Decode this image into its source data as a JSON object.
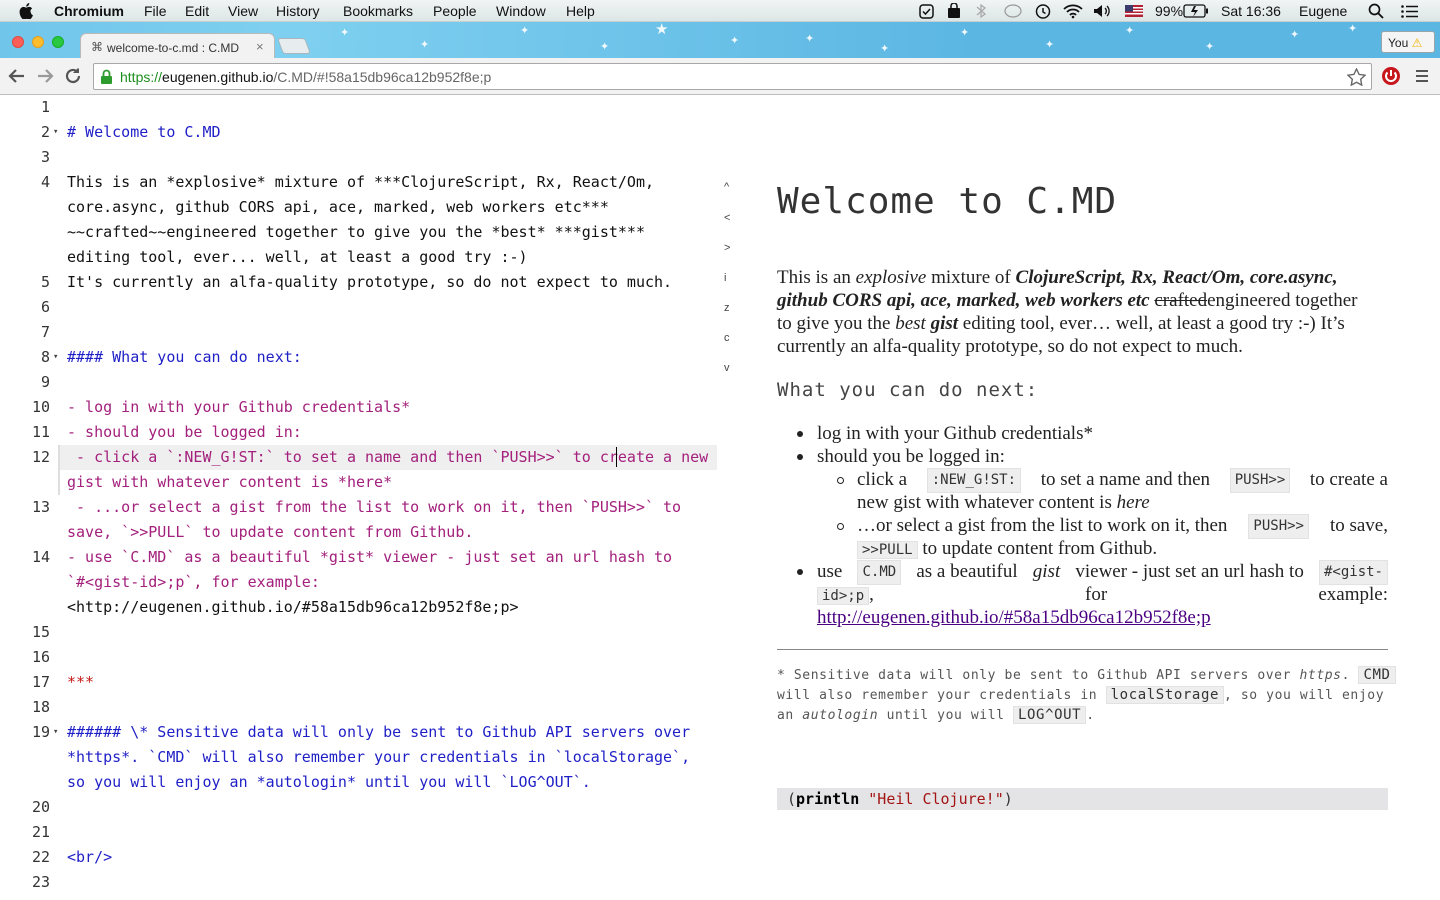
{
  "menubar": {
    "app": "Chromium",
    "items": [
      "File",
      "Edit",
      "View",
      "History",
      "Bookmarks",
      "People",
      "Window",
      "Help"
    ],
    "battery": "99%",
    "clock": "Sat 16:36",
    "user": "Eugene"
  },
  "browser": {
    "tab_title": "welcome-to-c.md : C.MD",
    "profile_label": "You",
    "url_scheme": "https://",
    "url_host": "eugenen.github.io",
    "url_path": "/C.MD/#!58a15db96ca12b952f8e;p"
  },
  "editor": {
    "line_numbers": [
      "1",
      "2",
      "3",
      "4",
      "5",
      "6",
      "7",
      "8",
      "9",
      "10",
      "11",
      "12",
      "13",
      "14",
      "15",
      "16",
      "17",
      "18",
      "19",
      "20",
      "21",
      "22",
      "23"
    ],
    "lines": {
      "l2": "# Welcome to C.MD",
      "l4a": "This is an *explosive* mixture of ***ClojureScript, Rx, React/Om,",
      "l4b": "core.async, github CORS api, ace, marked, web workers etc***",
      "l4c": "~~crafted~~engineered together to give you the *best* ***gist***",
      "l4d": "editing tool, ever... well, at least a good try :-)",
      "l5": "It's currently an alfa-quality prototype, so do not expect to much.",
      "l8": "#### What you can do next:",
      "l10": "- log in with your Github credentials*",
      "l11": "- should you be logged in:",
      "l12a": " - click a `:NEW_G!ST:` to set a name and then `PUSH>>` to create a new",
      "l12b": "gist with whatever content is *here*",
      "l13a": " - ...or select a gist from the list to work on it, then `PUSH>>` to",
      "l13b": "save, `>>PULL` to update content from Github.",
      "l14a": "- use `C.MD` as a beautiful *gist* viewer - just set an url hash to",
      "l14b": "`#<gist-id>;p`, for example:",
      "l14c": "<http://eugenen.github.io/#58a15db96ca12b952f8e;p>",
      "l17": "***",
      "l19a": "###### \\* Sensitive data will only be sent to Github API servers over",
      "l19b": "*https*. `CMD` will also remember your credentials in `localStorage`,",
      "l19c": "so you will enjoy an *autologin* until you will `LOG^OUT`.",
      "l22": "<br/>"
    },
    "side_nav": [
      "^",
      "<",
      ">",
      "i",
      "z",
      "c",
      "v"
    ]
  },
  "preview": {
    "title": "Welcome to C.MD",
    "intro": {
      "p1": "This is an",
      "em1": "explosive",
      "p2": "mixture of",
      "strong1": "ClojureScript, Rx, React/Om, core.async,",
      "strong2": "github CORS api, ace, marked, web workers etc",
      "strike": "crafted",
      "p3": "engineered together",
      "p4": "to give you the",
      "em2": "best",
      "strong3": "gist",
      "p5": "editing tool, ever… well, at least a good try :-) It’s",
      "p6": "currently an alfa-quality prototype, so do not expect to much."
    },
    "heading": "What you can do next:",
    "list": {
      "item1": "log in with your Github credentials*",
      "item2": "should you be logged in:",
      "sub1_a": "click a",
      "sub1_code1": ":NEW_G!ST:",
      "sub1_b": "to set a name and then",
      "sub1_code2": "PUSH>>",
      "sub1_c": "to create a",
      "sub1_d": "new gist with whatever content is",
      "sub1_em": "here",
      "sub2_a": "…or select a gist from the list to work on it, then",
      "sub2_code1": "PUSH>>",
      "sub2_b": "to save,",
      "sub2_code2": ">>PULL",
      "sub2_c": "to update content from Github.",
      "item3_a": "use",
      "item3_code1": "C.MD",
      "item3_b": "as a beautiful",
      "item3_em": "gist",
      "item3_c": "viewer - just set an url hash to",
      "item3_code2a": "#<gist-",
      "item3_code2b": "id>;p",
      "item3_d": ",",
      "item3_e": "for",
      "item3_f": "example:",
      "item3_link": "http://eugenen.github.io/#58a15db96ca12b952f8e;p"
    },
    "footnote": {
      "a": "* Sensitive data will only be sent to Github API servers over",
      "em1": "https",
      "b": ".",
      "code1": "CMD",
      "c": "will also remember your credentials in",
      "code2": "localStorage",
      "d": ", so you will enjoy",
      "e": "an",
      "em2": "autologin",
      "f": "until you will",
      "code3": "LOG^OUT",
      "g": "."
    },
    "code_kw": "println",
    "code_str": "\"Heil Clojure!\""
  }
}
